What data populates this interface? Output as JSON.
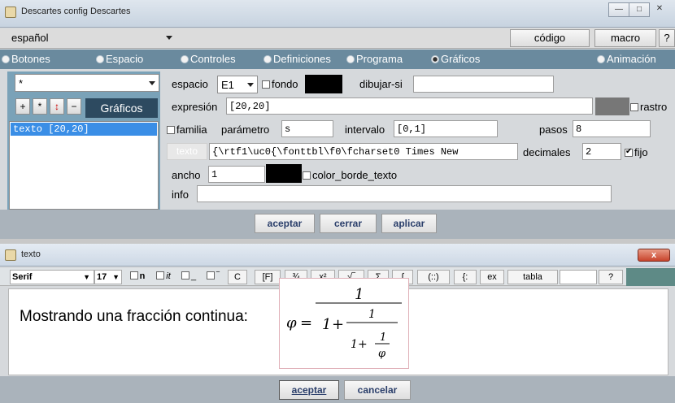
{
  "window1": {
    "title": "Descartes config Descartes",
    "controls": {
      "minimize": "—",
      "maximize": "□",
      "close": "✕"
    },
    "language": "español",
    "codigo": "código",
    "macro": "macro",
    "help": "?",
    "tabs": [
      {
        "label": "Botones",
        "selected": false
      },
      {
        "label": "Espacio",
        "selected": false
      },
      {
        "label": "Controles",
        "selected": false
      },
      {
        "label": "Definiciones",
        "selected": false
      },
      {
        "label": "Programa",
        "selected": false
      },
      {
        "label": "Gráficos",
        "selected": true
      },
      {
        "label": "Animación",
        "selected": false
      }
    ],
    "left": {
      "filter": "*",
      "buttons": [
        "+",
        "*",
        "↕",
        "−"
      ],
      "section": "Gráficos",
      "list_items": [
        "texto [20,20]"
      ]
    },
    "form": {
      "espacio_label": "espacio",
      "espacio_value": "E1",
      "fondo_label": "fondo",
      "fondo_color": "#000000",
      "dibujar_si_label": "dibujar-si",
      "dibujar_si_value": "",
      "expresion_label": "expresión",
      "expresion_value": "[20,20]",
      "rastro_label": "rastro",
      "rastro_color": "#777777",
      "familia_label": "familia",
      "parametro_label": "parámetro",
      "parametro_value": "s",
      "intervalo_label": "intervalo",
      "intervalo_value": "[0,1]",
      "pasos_label": "pasos",
      "pasos_value": "8",
      "texto_button": "texto",
      "texto_value": "{\\rtf1\\uc0{\\fonttbl\\f0\\fcharset0 Times New",
      "decimales_label": "decimales",
      "decimales_value": "2",
      "fijo_label": "fijo",
      "fijo_checked": true,
      "ancho_label": "ancho",
      "ancho_value": "1",
      "borde_color": "#000000",
      "color_borde_texto_label": "color_borde_texto",
      "info_label": "info",
      "info_value": ""
    },
    "footer": {
      "aceptar": "aceptar",
      "cerrar": "cerrar",
      "aplicar": "aplicar"
    }
  },
  "window2": {
    "title": "texto",
    "close": "x",
    "toolbar": {
      "font": "Serif",
      "size": "17",
      "bold": "n",
      "italic": "it",
      "underline": "_",
      "overline": "‾",
      "items": [
        "C",
        "[F]",
        "¾",
        "x²",
        "√‾",
        "Σ",
        "∫",
        "(::)",
        "{:",
        "ex",
        "tabla"
      ],
      "input_value": "",
      "help": "?"
    },
    "editor": {
      "text": "Mostrando una fracción continua:",
      "math": {
        "lhs": "φ",
        "eq": "=",
        "n1": "1",
        "d1": "1",
        "plus": "+",
        "n2": "1",
        "d2": "1",
        "n3": "1",
        "d3": "φ"
      }
    },
    "footer": {
      "aceptar": "aceptar",
      "cancelar": "cancelar"
    }
  },
  "colors": {
    "radio_bar": "#6a8a9e",
    "selected_list": "#3a8ee6",
    "graficos_label": "#2d4a60",
    "close_button": "#c8442c"
  }
}
